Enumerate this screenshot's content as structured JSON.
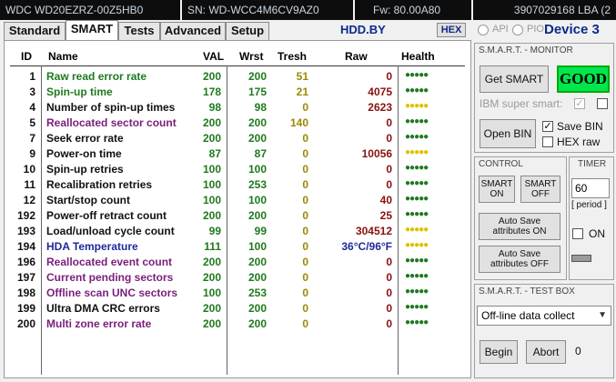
{
  "topbar": {
    "model": "WDC WD20EZRZ-00Z5HB0",
    "serial": "SN: WD-WCC4M6CV9AZ0",
    "firmware": "Fw: 80.00A80",
    "lba": "3907029168 LBA (2"
  },
  "tabs": [
    {
      "label": "Standard"
    },
    {
      "label": "SMART"
    },
    {
      "label": "Tests"
    },
    {
      "label": "Advanced"
    },
    {
      "label": "Setup"
    }
  ],
  "header": {
    "site": "HDD.BY",
    "hex_label": "HEX",
    "api_label": "API",
    "pio_label": "PIO",
    "device": "Device 3"
  },
  "table": {
    "columns": [
      "ID",
      "Name",
      "VAL",
      "Wrst",
      "Tresh",
      "Raw",
      "Health"
    ],
    "rows": [
      {
        "id": "1",
        "name": "Raw read error rate",
        "val": "200",
        "wrst": "200",
        "thr": "51",
        "raw": "0",
        "color": "#1e7a1e"
      },
      {
        "id": "3",
        "name": "Spin-up time",
        "val": "178",
        "wrst": "175",
        "thr": "21",
        "raw": "4075",
        "color": "#1e7a1e"
      },
      {
        "id": "4",
        "name": "Number of spin-up times",
        "val": "98",
        "wrst": "98",
        "thr": "0",
        "raw": "2623",
        "color": "#111111"
      },
      {
        "id": "5",
        "name": "Reallocated sector count",
        "val": "200",
        "wrst": "200",
        "thr": "140",
        "raw": "0",
        "color": "#7a1e7a"
      },
      {
        "id": "7",
        "name": "Seek error rate",
        "val": "200",
        "wrst": "200",
        "thr": "0",
        "raw": "0",
        "color": "#111111"
      },
      {
        "id": "9",
        "name": "Power-on time",
        "val": "87",
        "wrst": "87",
        "thr": "0",
        "raw": "10056",
        "color": "#111111"
      },
      {
        "id": "10",
        "name": "Spin-up retries",
        "val": "100",
        "wrst": "100",
        "thr": "0",
        "raw": "0",
        "color": "#111111"
      },
      {
        "id": "11",
        "name": "Recalibration retries",
        "val": "100",
        "wrst": "253",
        "thr": "0",
        "raw": "0",
        "color": "#111111"
      },
      {
        "id": "12",
        "name": "Start/stop count",
        "val": "100",
        "wrst": "100",
        "thr": "0",
        "raw": "40",
        "color": "#111111"
      },
      {
        "id": "192",
        "name": "Power-off retract count",
        "val": "200",
        "wrst": "200",
        "thr": "0",
        "raw": "25",
        "color": "#111111"
      },
      {
        "id": "193",
        "name": "Load/unload cycle count",
        "val": "99",
        "wrst": "99",
        "thr": "0",
        "raw": "304512",
        "color": "#111111"
      },
      {
        "id": "194",
        "name": "HDA Temperature",
        "val": "111",
        "wrst": "100",
        "thr": "0",
        "raw": "36°C/96°F",
        "color": "#1e2a9a"
      },
      {
        "id": "196",
        "name": "Reallocated event count",
        "val": "200",
        "wrst": "200",
        "thr": "0",
        "raw": "0",
        "color": "#7a1e7a"
      },
      {
        "id": "197",
        "name": "Current pending sectors",
        "val": "200",
        "wrst": "200",
        "thr": "0",
        "raw": "0",
        "color": "#7a1e7a"
      },
      {
        "id": "198",
        "name": "Offline scan UNC sectors",
        "val": "100",
        "wrst": "253",
        "thr": "0",
        "raw": "0",
        "color": "#7a1e7a"
      },
      {
        "id": "199",
        "name": "Ultra DMA CRC errors",
        "val": "200",
        "wrst": "200",
        "thr": "0",
        "raw": "0",
        "color": "#111111"
      },
      {
        "id": "200",
        "name": "Multi zone error rate",
        "val": "200",
        "wrst": "200",
        "thr": "0",
        "raw": "0",
        "color": "#7a1e7a"
      }
    ],
    "health_dots": [
      "green",
      "green",
      "yellow",
      "green",
      "green",
      "yellow",
      "green",
      "green",
      "green",
      "green",
      "yellow",
      "yellow",
      "green",
      "green",
      "green",
      "green",
      "green"
    ],
    "colors": {
      "val": "#1e7a1e",
      "thr": "#9a8a00",
      "raw": "#8a1010",
      "raw_temp": "#1e2a9a",
      "green": "#1e7a1e",
      "yellow": "#e0c000"
    }
  },
  "smart_monitor": {
    "title": "S.M.A.R.T. - MONITOR",
    "get_smart": "Get SMART",
    "status": "GOOD",
    "ibm_label": "IBM super smart:",
    "ibm_checked": "✓",
    "open_bin": "Open BIN",
    "save_bin": "Save BIN",
    "save_bin_checked": "✓",
    "hex_raw": "HEX raw"
  },
  "control": {
    "title": "CONTROL",
    "smart_on": "SMART ON",
    "smart_off": "SMART OFF",
    "autosave_on": "Auto Save attributes ON",
    "autosave_off": "Auto Save attributes OFF"
  },
  "timer": {
    "title": "TIMER",
    "value": "60",
    "period_label": "[ period ]",
    "on_label": "ON"
  },
  "testbox": {
    "title": "S.M.A.R.T. - TEST BOX",
    "selected": "Off-line data collect",
    "begin": "Begin",
    "abort": "Abort",
    "progress": "0"
  }
}
